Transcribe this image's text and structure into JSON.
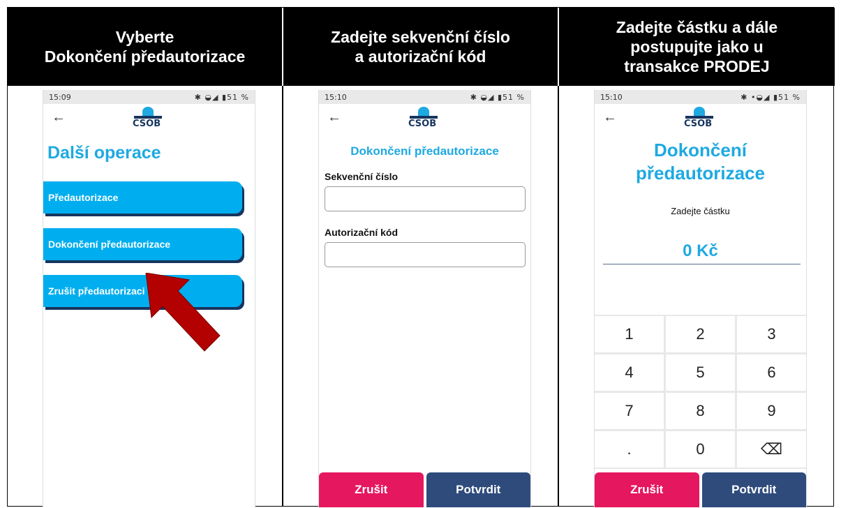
{
  "headers": [
    "Vyberte\nDokončení předautorizace",
    "Zadejte sekvenční číslo\na autorizační kód",
    "Zadejte částku a dále\npostupujte jako u\ntransakce PRODEJ"
  ],
  "screen1": {
    "time": "15:09",
    "status_icons": "✱ ◒◢ ▮51 %",
    "logo": "ČSOB",
    "title": "Další operace",
    "buttons": [
      "Předautorizace",
      "Dokončení předautorizace",
      "Zrušit předautorizaci"
    ]
  },
  "screen2": {
    "time": "15:10",
    "status_icons": "✱ ◒◢ ▮51 %",
    "logo": "ČSOB",
    "title": "Dokončení předautorizace",
    "field1_label": "Sekvenční číslo",
    "field1_value": "",
    "field2_label": "Autorizační kód",
    "field2_value": "",
    "cancel": "Zrušit",
    "confirm": "Potvrdit"
  },
  "screen3": {
    "time": "15:10",
    "status_icons": "✱ •◒◢ ▮51 %",
    "logo": "ČSOB",
    "title": "Dokončení\npředautorizace",
    "prompt": "Zadejte částku",
    "amount": "0 Kč",
    "keys": [
      "1",
      "2",
      "3",
      "4",
      "5",
      "6",
      "7",
      "8",
      "9",
      ".",
      "0",
      "⌫"
    ],
    "cancel": "Zrušit",
    "confirm": "Potvrdit"
  },
  "colors": {
    "accent": "#1ea9e1",
    "button": "#00aeef",
    "cancel": "#e5175e",
    "confirm": "#2f4b7c",
    "arrow": "#b30000"
  },
  "icons": {
    "back": "back-arrow-icon",
    "backspace": "backspace-icon",
    "pointer": "red-pointer-arrow-icon"
  }
}
